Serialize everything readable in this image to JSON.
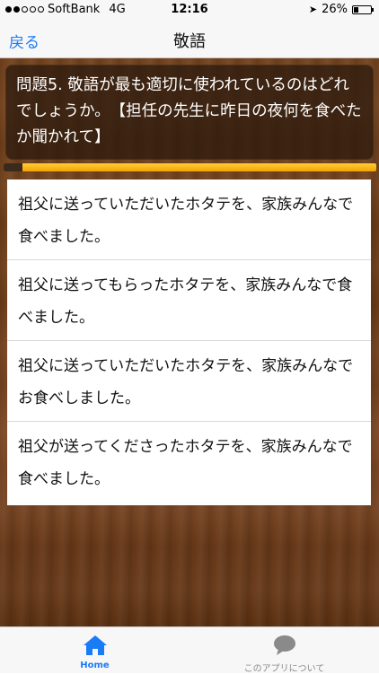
{
  "status_bar": {
    "carrier": "SoftBank",
    "network": "4G",
    "time": "12:16",
    "battery": "26%",
    "battery_level": 0.26,
    "signal_bars_filled": 2,
    "signal_bars_total": 5
  },
  "nav": {
    "back_label": "戻る",
    "title": "敬語"
  },
  "question": {
    "text": "問題5. 敬語が最も適切に使われているのはどれでしょうか。　【担任の先生に昨日の夜何を食べたか聞かれて】"
  },
  "progress": {
    "value": 0.05
  },
  "answers": [
    {
      "text": "祖父に送っていただいたホタテを、家族みんなで食べました。"
    },
    {
      "text": "祖父に送ってもらったホタテを、家族みんなで食べました。"
    },
    {
      "text": "祖父に送っていただいたホタテを、家族みんなでお食べしました。"
    },
    {
      "text": "祖父が送ってくださったホタテを、家族みんなで食べました。"
    }
  ],
  "tabs": [
    {
      "label": "Home",
      "icon": "home-icon",
      "selected": true
    },
    {
      "label": "このアプリについて",
      "icon": "speech-bubble-icon",
      "selected": false
    }
  ],
  "colors": {
    "accent": "#1a7bf7",
    "progress_bar": "#f2a400",
    "wood": "#6e3d17"
  }
}
